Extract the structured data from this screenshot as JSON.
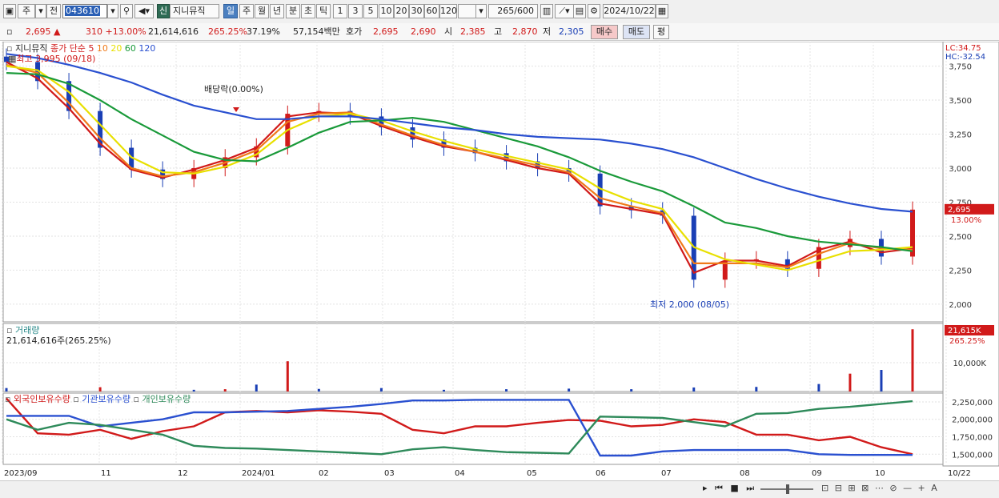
{
  "toolbar": {
    "market": "주",
    "prev": "전",
    "code": "043610",
    "badge": "신",
    "name": "지니뮤직",
    "periods": [
      "일",
      "주",
      "월",
      "년",
      "분",
      "초",
      "틱"
    ],
    "active_period": "일",
    "minutes": [
      "1",
      "3",
      "5",
      "10",
      "20",
      "30",
      "60",
      "120"
    ],
    "count": "265/600",
    "date": "2024/10/22"
  },
  "quote": {
    "price": "2,695",
    "change": "310 +13.00%",
    "volume": "21,614,616",
    "vol_ratio": "265.25%",
    "turnover": "37.19%",
    "amount": "57,154백만",
    "bid_label": "호가",
    "ask": "2,695",
    "bid": "2,690",
    "open_label": "시",
    "open": "2,385",
    "high_label": "고",
    "high": "2,870",
    "low_label": "저",
    "low": "2,305",
    "buy": "매수",
    "sell": "매도",
    "eval": "평"
  },
  "legend": {
    "name": "지니뮤직",
    "ma_label": "종가 단순",
    "ma_periods": [
      "5",
      "10",
      "20",
      "60",
      "120"
    ],
    "ma_colors": [
      "#d11a1a",
      "#f07a1a",
      "#e8e000",
      "#1a9a3a",
      "#2a50d0"
    ],
    "max_label": "최고 3,995 (09/18)",
    "min_label": "최저 2,000 (08/05)",
    "dividend_label": "배당락(0.00%)",
    "lc": "LC:34.75",
    "hc": "HC:-32.54",
    "last_price_tag": "2,695",
    "last_pct_tag": "13.00%"
  },
  "volume_panel": {
    "title": "거래량",
    "value": "21,614,616주(265.25%)",
    "tag": "21,615K",
    "tag_pct": "265.25%",
    "ticks": [
      "10,000K"
    ]
  },
  "holdings_panel": {
    "legends": [
      "외국인보유수량",
      "기관보유수량",
      "개인보유수량"
    ],
    "colors": [
      "#d11a1a",
      "#2a50d0",
      "#2e8a5a"
    ],
    "ticks": [
      "2,250,000",
      "2,000,000",
      "1,750,000",
      "1,500,000"
    ]
  },
  "chart_data": {
    "type": "line",
    "title": "",
    "price_axis": {
      "ticks": [
        3750,
        3500,
        3250,
        3000,
        2750,
        2500,
        2250,
        2000
      ],
      "range": [
        1870,
        3930
      ]
    },
    "x_labels": [
      "2023/09",
      "11",
      "12",
      "2024/01",
      "02",
      "03",
      "04",
      "05",
      "06",
      "07",
      "08",
      "09",
      "10",
      "10/22"
    ],
    "price_close": [
      3780,
      3640,
      3420,
      3150,
      2990,
      2920,
      3000,
      3080,
      3160,
      3400,
      3420,
      3380,
      3300,
      3210,
      3150,
      3110,
      3050,
      3000,
      2960,
      2720,
      2690,
      2650,
      2180,
      2320,
      2330,
      2260,
      2420,
      2480,
      2350,
      2695
    ],
    "ma": [
      {
        "name": "5",
        "values": [
          3780,
          3660,
          3440,
          3180,
          2990,
          2930,
          2990,
          3060,
          3150,
          3380,
          3410,
          3400,
          3310,
          3230,
          3160,
          3120,
          3060,
          3000,
          2960,
          2740,
          2700,
          2660,
          2230,
          2320,
          2320,
          2280,
          2400,
          2460,
          2380,
          2410
        ]
      },
      {
        "name": "10",
        "values": [
          3760,
          3700,
          3480,
          3220,
          3000,
          2940,
          2970,
          3040,
          3130,
          3340,
          3400,
          3410,
          3320,
          3240,
          3170,
          3120,
          3070,
          3020,
          2970,
          2780,
          2720,
          2670,
          2300,
          2300,
          2300,
          2270,
          2370,
          2450,
          2410,
          2400
        ]
      },
      {
        "name": "20",
        "values": [
          3750,
          3720,
          3560,
          3320,
          3080,
          2970,
          2960,
          3010,
          3100,
          3280,
          3380,
          3400,
          3350,
          3270,
          3200,
          3140,
          3090,
          3040,
          2990,
          2850,
          2760,
          2700,
          2420,
          2330,
          2290,
          2250,
          2320,
          2390,
          2400,
          2420
        ]
      },
      {
        "name": "60",
        "values": [
          3700,
          3690,
          3620,
          3500,
          3360,
          3240,
          3120,
          3060,
          3050,
          3150,
          3260,
          3340,
          3350,
          3370,
          3340,
          3280,
          3220,
          3160,
          3080,
          2980,
          2900,
          2830,
          2720,
          2600,
          2560,
          2500,
          2460,
          2440,
          2420,
          2390
        ]
      },
      {
        "name": "120",
        "values": [
          3840,
          3810,
          3760,
          3700,
          3630,
          3540,
          3460,
          3410,
          3360,
          3360,
          3380,
          3380,
          3360,
          3330,
          3300,
          3280,
          3250,
          3230,
          3220,
          3210,
          3180,
          3140,
          3080,
          3000,
          2920,
          2850,
          2790,
          2740,
          2700,
          2680
        ]
      }
    ],
    "volume": [
      {
        "i": 0,
        "v": 1.2
      },
      {
        "i": 3,
        "v": 1.5
      },
      {
        "i": 6,
        "v": 0.6
      },
      {
        "i": 7,
        "v": 0.8
      },
      {
        "i": 8,
        "v": 2.4
      },
      {
        "i": 9,
        "v": 10.5
      },
      {
        "i": 10,
        "v": 0.9
      },
      {
        "i": 12,
        "v": 1.2
      },
      {
        "i": 14,
        "v": 0.6
      },
      {
        "i": 16,
        "v": 0.8
      },
      {
        "i": 18,
        "v": 1.0
      },
      {
        "i": 20,
        "v": 0.8
      },
      {
        "i": 22,
        "v": 1.4
      },
      {
        "i": 24,
        "v": 1.6
      },
      {
        "i": 26,
        "v": 2.6
      },
      {
        "i": 27,
        "v": 6.2
      },
      {
        "i": 28,
        "v": 7.5
      },
      {
        "i": 29,
        "v": 21.6
      }
    ],
    "volume_max": 22.5,
    "holdings_range": [
      1400000,
      2330000
    ],
    "holdings": [
      {
        "name": "외국인보유수량",
        "values": [
          2300000,
          1800000,
          1780000,
          1850000,
          1720000,
          1830000,
          1900000,
          2100000,
          2120000,
          2100000,
          2130000,
          2110000,
          2080000,
          1850000,
          1800000,
          1900000,
          1900000,
          1950000,
          1990000,
          1980000,
          1900000,
          1920000,
          2000000,
          1960000,
          1780000,
          1780000,
          1700000,
          1750000,
          1600000,
          1500000
        ]
      },
      {
        "name": "기관보유수량",
        "values": [
          2050000,
          2050000,
          2050000,
          1900000,
          1950000,
          2000000,
          2100000,
          2100000,
          2110000,
          2120000,
          2150000,
          2180000,
          2220000,
          2270000,
          2270000,
          2280000,
          2280000,
          2280000,
          2280000,
          1480000,
          1480000,
          1540000,
          1560000,
          1560000,
          1560000,
          1560000,
          1500000,
          1490000,
          1490000,
          1490000
        ]
      },
      {
        "name": "개인보유수량",
        "values": [
          2000000,
          1850000,
          1950000,
          1920000,
          1850000,
          1780000,
          1620000,
          1590000,
          1580000,
          1560000,
          1540000,
          1520000,
          1500000,
          1570000,
          1600000,
          1560000,
          1530000,
          1520000,
          1510000,
          2040000,
          2030000,
          2020000,
          1960000,
          1900000,
          2080000,
          2090000,
          2150000,
          2180000,
          2220000,
          2260000
        ]
      }
    ]
  }
}
